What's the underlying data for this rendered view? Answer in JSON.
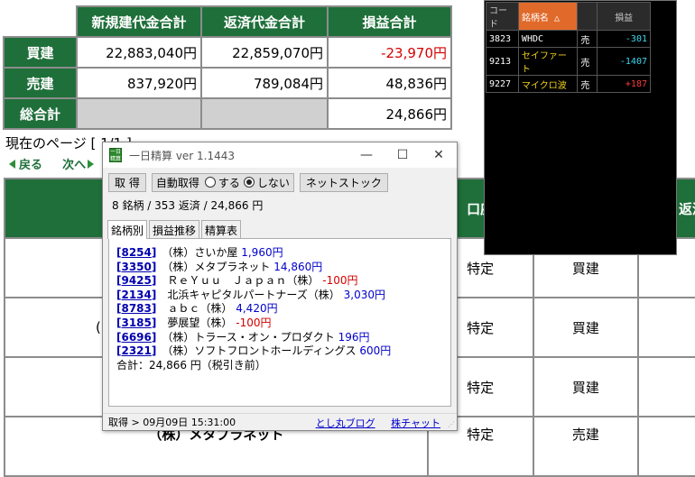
{
  "summary": {
    "headers": [
      "新規建代金合計",
      "返済代金合計",
      "損益合計"
    ],
    "rows": [
      {
        "label": "買建",
        "new_total": "22,883,040円",
        "repay_total": "22,859,070円",
        "pl": "-23,970円",
        "pl_negative": true
      },
      {
        "label": "売建",
        "new_total": "837,920円",
        "repay_total": "789,084円",
        "pl": "48,836円",
        "pl_negative": false
      },
      {
        "label": "総合計",
        "new_total": "",
        "repay_total": "",
        "pl": "24,866円",
        "pl_negative": false
      }
    ]
  },
  "page_info": "現在のページ [ 1/1 ]",
  "nav": {
    "back": "戻る",
    "next": "次へ"
  },
  "bg_table": {
    "partial_header_1": "口座",
    "partial_header_2": "返済",
    "rows": [
      {
        "partial_name": "",
        "account": "特定",
        "side": "買建"
      },
      {
        "partial_name": "(",
        "account": "特定",
        "side": "買建"
      },
      {
        "partial_name": "",
        "account": "特定",
        "side": "買建"
      },
      {
        "partial_name": "（株）メタプラネット",
        "account": "特定",
        "side": "売建"
      }
    ]
  },
  "ticker": {
    "headers": {
      "code": "コード",
      "name": "銘柄名 △",
      "side": "",
      "pl": "損益"
    },
    "rows": [
      {
        "code": "3823",
        "name": "WHDC",
        "side": "売",
        "pl": "-301",
        "pl_color": "#3fd7f0",
        "name_color": "#ffffff"
      },
      {
        "code": "9213",
        "name": "セイファート",
        "side": "売",
        "pl": "-1407",
        "pl_color": "#3fd7f0",
        "name_color": "#f3d21b"
      },
      {
        "code": "9227",
        "name": "マイクロ波",
        "side": "売",
        "pl": "+187",
        "pl_color": "#ff3b3b",
        "name_color": "#f3d21b"
      }
    ]
  },
  "window": {
    "icon_text": "一日精算",
    "title": "一日精算 ver 1.1443",
    "controls": {
      "minimize": "—",
      "maximize": "☐",
      "close": "✕"
    },
    "toolbar": {
      "fetch_button": "取 得",
      "auto_fetch_label": "自動取得",
      "radio_on": "する",
      "radio_off": "しない",
      "radio_selected": "off",
      "netstock_button": "ネットストック"
    },
    "stats": "8 銘柄 / 353 返済 / 24,866 円",
    "tabs": [
      "銘柄別",
      "損益推移",
      "精算表"
    ],
    "active_tab": 0,
    "items": [
      {
        "code": "8254",
        "name": "（株）さいか屋",
        "pl": "1,960円",
        "negative": false
      },
      {
        "code": "3350",
        "name": "（株）メタプラネット",
        "pl": "14,860円",
        "negative": false
      },
      {
        "code": "9425",
        "name": "ＲｅＹｕｕ　Ｊａｐａｎ（株）",
        "pl": "-100円",
        "negative": true
      },
      {
        "code": "2134",
        "name": "北浜キャピタルパートナーズ（株）",
        "pl": "3,030円",
        "negative": false
      },
      {
        "code": "8783",
        "name": "ａｂｃ（株）",
        "pl": "4,420円",
        "negative": false
      },
      {
        "code": "3185",
        "name": "夢展望（株）",
        "pl": "-100円",
        "negative": true
      },
      {
        "code": "6696",
        "name": "（株）トラース・オン・プロダクト",
        "pl": "196円",
        "negative": false
      },
      {
        "code": "2321",
        "name": "（株）ソフトフロントホールディングス",
        "pl": "600円",
        "negative": false
      }
    ],
    "total": "合計：24,866 円（税引き前）",
    "status": "取得 > 09月09日 15:31:00",
    "links": [
      "とし丸ブログ",
      "株チャット"
    ]
  }
}
